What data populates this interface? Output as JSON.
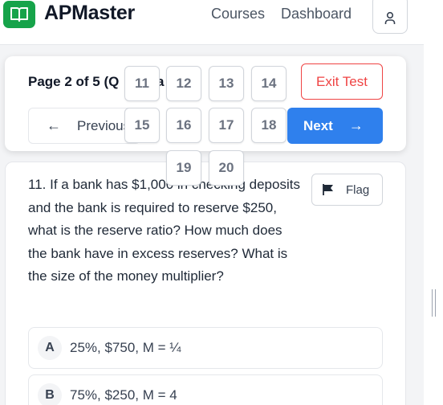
{
  "header": {
    "brand": "APMaster",
    "nav": {
      "courses": "Courses",
      "dashboard": "Dashboard"
    }
  },
  "test_nav": {
    "page_info_visible": "Page 2 of 5 (Q",
    "page_info_tail": "a",
    "exit_label": "Exit Test",
    "prev_label": "Previous",
    "next_label": "Next",
    "question_numbers": [
      "11",
      "12",
      "13",
      "14",
      "15",
      "16",
      "17",
      "18",
      "19",
      "20"
    ]
  },
  "question": {
    "text": "11. If a bank has $1,000 in checking deposits and the bank is required to reserve $250, what is the reserve ratio? How much does the bank have in excess reserves? What is the size of the money multiplier?",
    "flag_label": "Flag",
    "choices": [
      {
        "letter": "A",
        "text": "25%, $750, M = ¼"
      },
      {
        "letter": "B",
        "text": "75%, $250, M = 4"
      }
    ]
  },
  "colors": {
    "brand_green": "#16a34a",
    "exit_red": "#ef4444",
    "next_blue": "#2f80ed"
  },
  "icons": {
    "logo": "open-book-icon",
    "avatar": "user-icon",
    "prev": "arrow-left-icon",
    "next": "arrow-right-icon",
    "flag": "flag-icon"
  }
}
